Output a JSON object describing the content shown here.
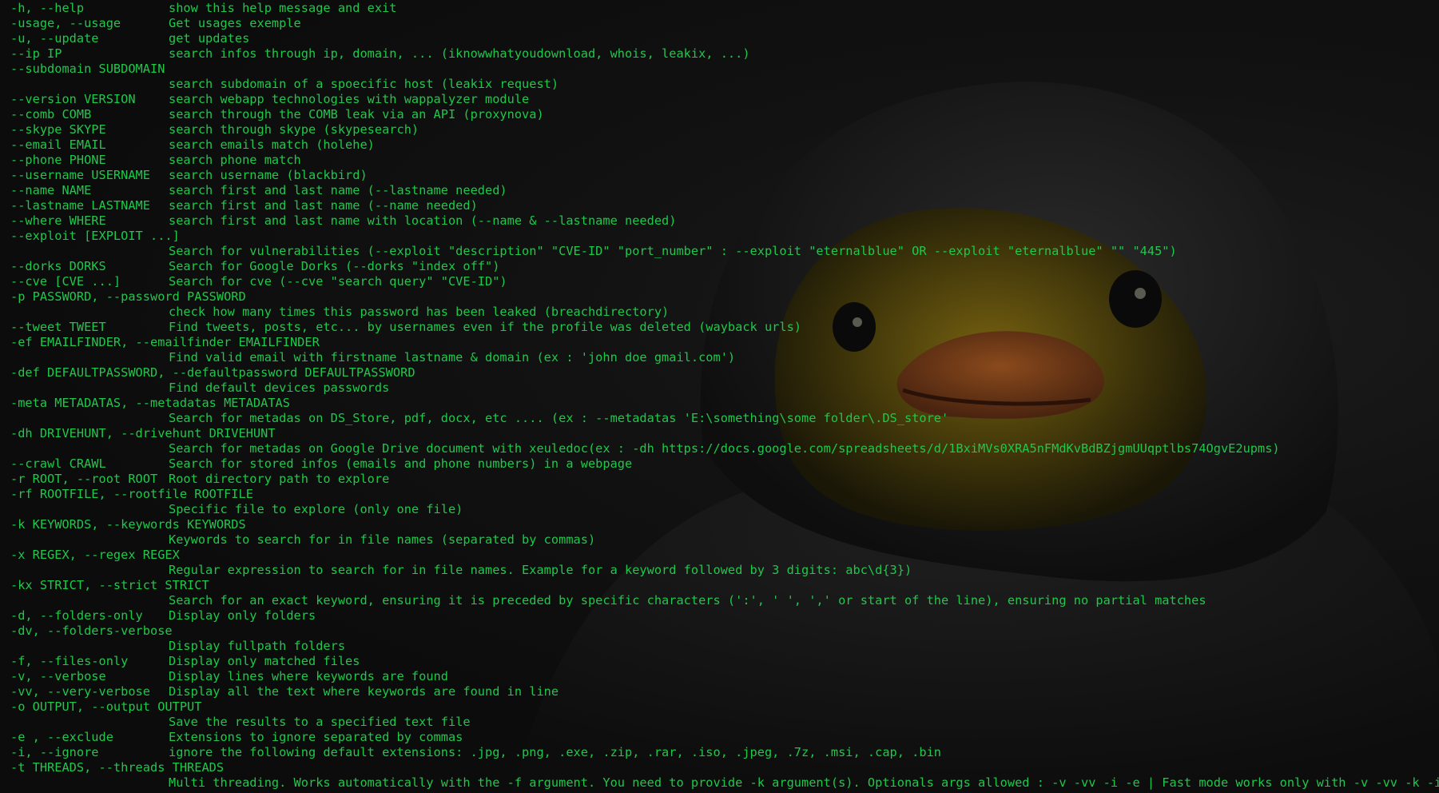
{
  "terminal": {
    "text_color": "#1fc84a",
    "background_color": "#0c0c0c",
    "background_image": "hooded-duck-icon",
    "lines": [
      {
        "opt": "-h, --help",
        "desc": "show this help message and exit"
      },
      {
        "opt": "-usage, --usage",
        "desc": "Get usages exemple"
      },
      {
        "opt": "-u, --update",
        "desc": "get updates"
      },
      {
        "opt": "--ip IP",
        "desc": "search infos through ip, domain, ... (iknowwhatyoudownload, whois, leakix, ...)"
      },
      {
        "opt": "--subdomain SUBDOMAIN",
        "desc": ""
      },
      {
        "opt": "",
        "desc": "search subdomain of a spoecific host (leakix request)"
      },
      {
        "opt": "--version VERSION",
        "desc": "search webapp technologies with wappalyzer module"
      },
      {
        "opt": "--comb COMB",
        "desc": "search through the COMB leak via an API (proxynova)"
      },
      {
        "opt": "--skype SKYPE",
        "desc": "search through skype (skypesearch)"
      },
      {
        "opt": "--email EMAIL",
        "desc": "search emails match (holehe)"
      },
      {
        "opt": "--phone PHONE",
        "desc": "search phone match"
      },
      {
        "opt": "--username USERNAME",
        "desc": "search username (blackbird)"
      },
      {
        "opt": "--name NAME",
        "desc": "search first and last name (--lastname needed)"
      },
      {
        "opt": "--lastname LASTNAME",
        "desc": "search first and last name (--name needed)"
      },
      {
        "opt": "--where WHERE",
        "desc": "search first and last name with location (--name & --lastname needed)"
      },
      {
        "opt": "--exploit [EXPLOIT ...]",
        "desc": ""
      },
      {
        "opt": "",
        "desc": "Search for vulnerabilities (--exploit \"description\" \"CVE-ID\" \"port_number\" : --exploit \"eternalblue\" OR --exploit \"eternalblue\" \"\" \"445\")"
      },
      {
        "opt": "--dorks DORKS",
        "desc": "Search for Google Dorks (--dorks \"index off\")"
      },
      {
        "opt": "--cve [CVE ...]",
        "desc": "Search for cve (--cve \"search query\" \"CVE-ID\")"
      },
      {
        "opt": "-p PASSWORD, --password PASSWORD",
        "desc": ""
      },
      {
        "opt": "",
        "desc": "check how many times this password has been leaked (breachdirectory)"
      },
      {
        "opt": "--tweet TWEET",
        "desc": "Find tweets, posts, etc... by usernames even if the profile was deleted (wayback urls)"
      },
      {
        "opt": "-ef EMAILFINDER, --emailfinder EMAILFINDER",
        "desc": ""
      },
      {
        "opt": "",
        "desc": "Find valid email with firstname lastname & domain (ex : 'john doe gmail.com')"
      },
      {
        "opt": "-def DEFAULTPASSWORD, --defaultpassword DEFAULTPASSWORD",
        "desc": ""
      },
      {
        "opt": "",
        "desc": "Find default devices passwords"
      },
      {
        "opt": "-meta METADATAS, --metadatas METADATAS",
        "desc": ""
      },
      {
        "opt": "",
        "desc": "Search for metadas on DS_Store, pdf, docx, etc .... (ex : --metadatas 'E:\\something\\some folder\\.DS_store'"
      },
      {
        "opt": "-dh DRIVEHUNT, --drivehunt DRIVEHUNT",
        "desc": ""
      },
      {
        "opt": "",
        "desc": "Search for metadas on Google Drive document with xeuledoc(ex : -dh https://docs.google.com/spreadsheets/d/1BxiMVs0XRA5nFMdKvBdBZjgmUUqptlbs74OgvE2upms)"
      },
      {
        "opt": "--crawl CRAWL",
        "desc": "Search for stored infos (emails and phone numbers) in a webpage"
      },
      {
        "opt": "-r ROOT, --root ROOT",
        "desc": "Root directory path to explore"
      },
      {
        "opt": "-rf ROOTFILE, --rootfile ROOTFILE",
        "desc": ""
      },
      {
        "opt": "",
        "desc": "Specific file to explore (only one file)"
      },
      {
        "opt": "-k KEYWORDS, --keywords KEYWORDS",
        "desc": ""
      },
      {
        "opt": "",
        "desc": "Keywords to search for in file names (separated by commas)"
      },
      {
        "opt": "-x REGEX, --regex REGEX",
        "desc": ""
      },
      {
        "opt": "",
        "desc": "Regular expression to search for in file names. Example for a keyword followed by 3 digits: abc\\d{3})"
      },
      {
        "opt": "-kx STRICT, --strict STRICT",
        "desc": ""
      },
      {
        "opt": "",
        "desc": "Search for an exact keyword, ensuring it is preceded by specific characters (':', ' ', ',' or start of the line), ensuring no partial matches"
      },
      {
        "opt": "-d, --folders-only",
        "desc": "Display only folders"
      },
      {
        "opt": "-dv, --folders-verbose",
        "desc": ""
      },
      {
        "opt": "",
        "desc": "Display fullpath folders"
      },
      {
        "opt": "-f, --files-only",
        "desc": "Display only matched files"
      },
      {
        "opt": "-v, --verbose",
        "desc": "Display lines where keywords are found"
      },
      {
        "opt": "-vv, --very-verbose",
        "desc": "Display all the text where keywords are found in line"
      },
      {
        "opt": "-o OUTPUT, --output OUTPUT",
        "desc": ""
      },
      {
        "opt": "",
        "desc": "Save the results to a specified text file"
      },
      {
        "opt": "-e , --exclude",
        "desc": "Extensions to ignore separated by commas"
      },
      {
        "opt": "-i, --ignore",
        "desc": "ignore the following default extensions: .jpg, .png, .exe, .zip, .rar, .iso, .jpeg, .7z, .msi, .cap, .bin"
      },
      {
        "opt": "-t THREADS, --threads THREADS",
        "desc": ""
      },
      {
        "opt": "",
        "desc": "Multi threading. Works automatically with the -f argument. You need to provide -k argument(s). Optionals args allowed : -v -vv -i -e | Fast mode works only with -v -vv -k -i -e"
      }
    ]
  }
}
